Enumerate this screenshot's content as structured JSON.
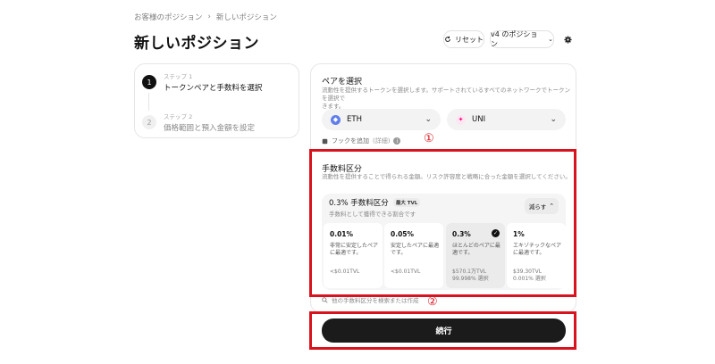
{
  "breadcrumb": {
    "parent": "お客様のポジション",
    "separator": "›",
    "current": "新しいポジション"
  },
  "page_title": "新しいポジション",
  "header": {
    "reset_label": "リセット",
    "version_label": "v4 のポジション"
  },
  "steps": [
    {
      "sub": "ステップ 1",
      "label": "トークンペアと手数料を選択",
      "num": "1"
    },
    {
      "sub": "ステップ 2",
      "label": "価格範囲と預入金額を設定",
      "num": "2"
    }
  ],
  "pair": {
    "title": "ペアを選択",
    "desc_line1": "流動性を提供するトークンを選択します。サポートされているすべてのネットワークでトークンを選択で",
    "desc_line2": "きます。",
    "token_a": "ETH",
    "token_b": "UNI",
    "hook_label": "フックを追加",
    "hook_detail": "(詳細)"
  },
  "annotations": {
    "marker1": "①",
    "marker2": "②"
  },
  "fee": {
    "title": "手数料区分",
    "desc": "流動性を提供することで得られる金額。リスク許容度と戦略に合った金額を選択してください。",
    "selected_title": "0.3% 手数料区分",
    "badge": "最大 TVL",
    "selected_sub": "手数料として獲得できる割合です",
    "shrink_label": "減らす",
    "tiers": [
      {
        "pct": "0.01%",
        "desc": "非常に安定したペアに最適です。",
        "tvl": "<$0.01TVL",
        "select": ""
      },
      {
        "pct": "0.05%",
        "desc": "安定したペアに最適です。",
        "tvl": "<$0.01TVL",
        "select": ""
      },
      {
        "pct": "0.3%",
        "desc": "ほとんどのペアに最適です。",
        "tvl": "$570.1万TVL",
        "select": "99.998% 選択"
      },
      {
        "pct": "1%",
        "desc": "エキゾチックなペアに最適です。",
        "tvl": "$39.30TVL",
        "select": "0.001% 選択"
      }
    ],
    "search_label": "他の手数料区分を検索または作成"
  },
  "continue_label": "続行"
}
